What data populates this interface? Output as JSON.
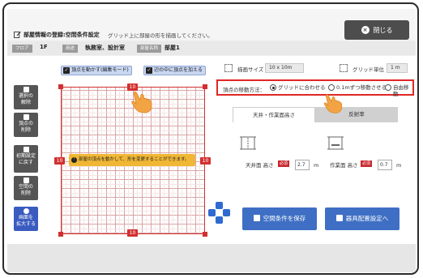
{
  "header": {
    "title": "部屋情報の登録:空間条件設定",
    "subtitle": "グリッド上に部屋の形を描画してください。",
    "close_label": "閉じる"
  },
  "info": {
    "floor_chip": "フロア",
    "floor_value": "1F",
    "use_chip": "用途",
    "use_value": "執務室、設計室",
    "room_chip": "部屋名称",
    "room_value": "部屋1"
  },
  "sidebar": {
    "items": [
      {
        "label": "選択の\n解除",
        "icon": "lock-icon"
      },
      {
        "label": "頂点の\n削除",
        "icon": "trash-icon"
      },
      {
        "label": "初期設定\nに戻す",
        "icon": "reset-icon"
      },
      {
        "label": "空間の\n削除",
        "icon": "trash-icon"
      },
      {
        "label": "画面を\n拡大する",
        "icon": "zoom-icon"
      }
    ]
  },
  "toolbar": {
    "move_vertex": "頂点を動かす(編集モード)",
    "add_vertex": "辺の中に頂点を加える"
  },
  "grid": {
    "dim_top": "10",
    "dim_left": "10",
    "dim_right": "10",
    "dim_bottom": "10",
    "notice": "部屋の頂点を動かして、形を変更することができます。"
  },
  "params": {
    "drawing_size_label": "描画サイズ",
    "drawing_size_value": "10 x 10m",
    "grid_unit_label": "グリッド単位",
    "grid_unit_value": "1 m"
  },
  "vertex_move": {
    "label": "頂点の移動方法：",
    "options": [
      "グリッドに合わせる",
      "0.1mずつ移動させる",
      "自由移動"
    ],
    "selected": "グリッドに合わせる"
  },
  "tabs": {
    "ceiling_work": "天井・作業面高さ",
    "reflectance": "反射率"
  },
  "heights": {
    "ceiling_label": "天井面 高さ",
    "ceiling_value": "2.7",
    "work_label": "作業面 高さ",
    "work_value": "0.7",
    "required": "必須",
    "unit": "m"
  },
  "actions": {
    "save": "空間条件を保存",
    "layout": "器具配置設定へ"
  },
  "colors": {
    "accent_red": "#d23030",
    "primary_blue": "#3f6fc4",
    "notice_yellow": "#f0b735",
    "dark_button": "#4d4d4d"
  }
}
